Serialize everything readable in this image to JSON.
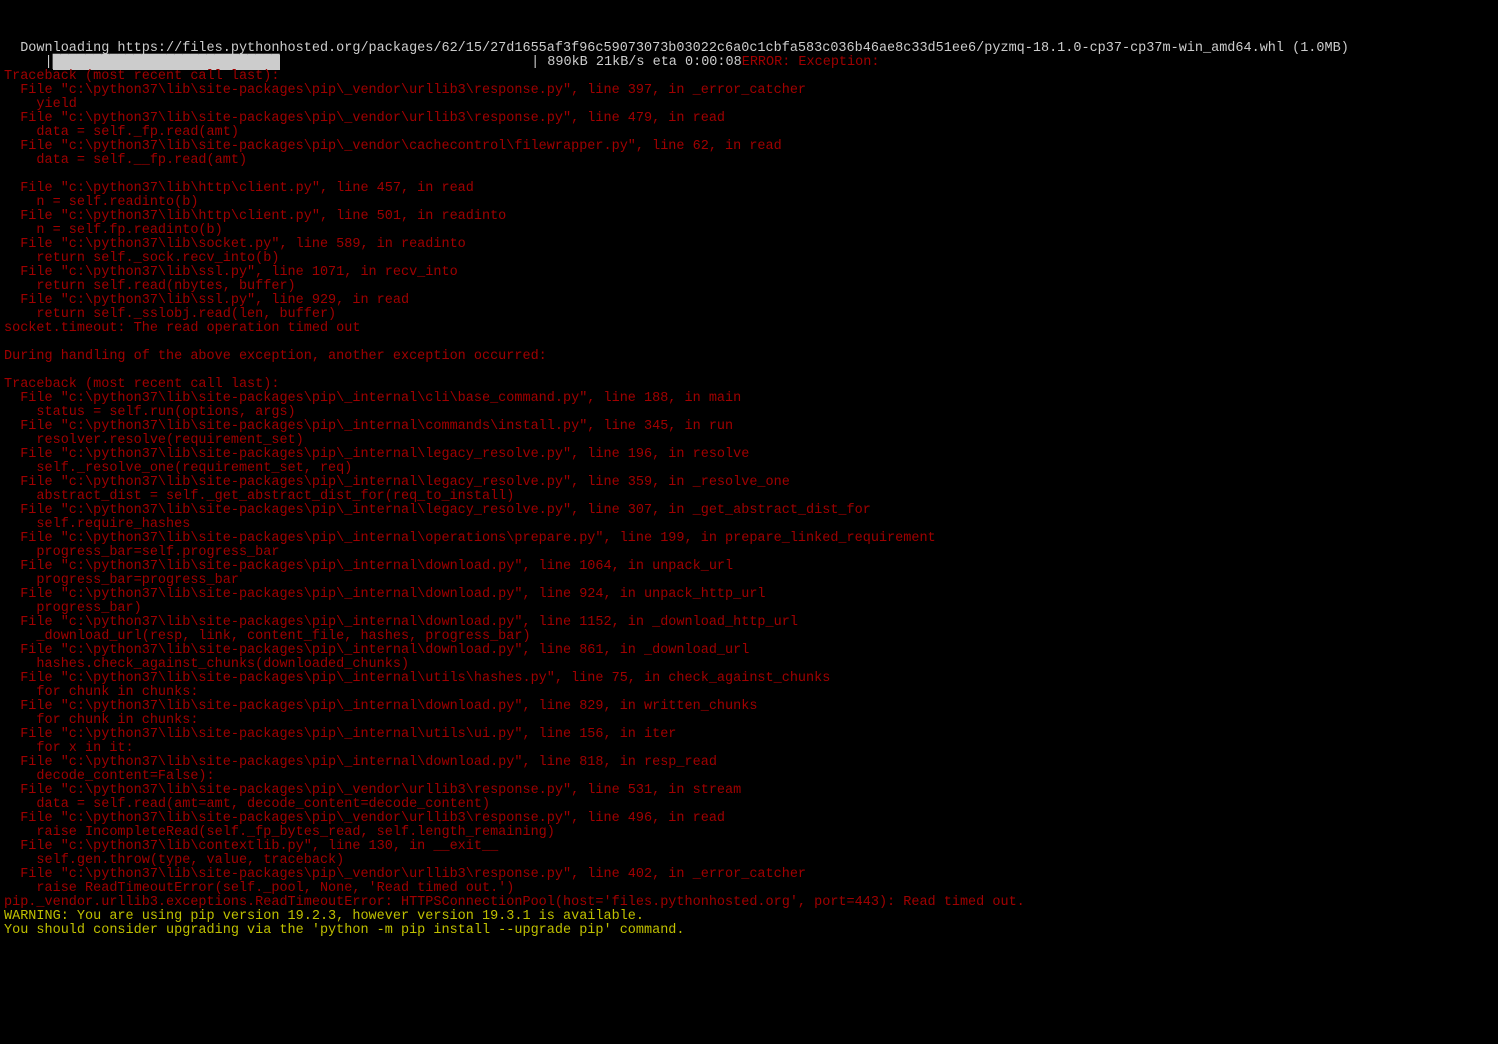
{
  "blank": " ",
  "progress": {
    "prefix": "     ",
    "filled": 28,
    "total": 59,
    "fillchar": "█",
    "emptychar": " ",
    "suffix": "| 890kB 21kB/s eta 0:00:08"
  },
  "lines": {
    "download": "  Downloading https://files.pythonhosted.org/packages/62/15/27d1655af3f96c59073073b03022c6a0c1cbfa583c036b46ae8c33d51ee6/pyzmq-18.1.0-cp37-cp37m-win_amd64.whl (1.0MB)",
    "errlabel": "ERROR: Exception:",
    "during": "During handling of the above exception, another exception occurred:",
    "warn1": "WARNING: You are using pip version 19.2.3, however version 19.3.1 is available.",
    "warn2": "You should consider upgrading via the 'python -m pip install --upgrade pip' command."
  },
  "tb1": {
    "l0": "Traceback (most recent call last):",
    "l1": "  File \"c:\\python37\\lib\\site-packages\\pip\\_vendor\\urllib3\\response.py\", line 397, in _error_catcher",
    "l2": "    yield",
    "l3": "  File \"c:\\python37\\lib\\site-packages\\pip\\_vendor\\urllib3\\response.py\", line 479, in read",
    "l4": "    data = self._fp.read(amt)",
    "l5": "  File \"c:\\python37\\lib\\site-packages\\pip\\_vendor\\cachecontrol\\filewrapper.py\", line 62, in read",
    "l6": "    data = self.__fp.read(amt)",
    "l7": " ",
    "l8": "  File \"c:\\python37\\lib\\http\\client.py\", line 457, in read",
    "l9": "    n = self.readinto(b)",
    "l10": "  File \"c:\\python37\\lib\\http\\client.py\", line 501, in readinto",
    "l11": "    n = self.fp.readinto(b)",
    "l12": "  File \"c:\\python37\\lib\\socket.py\", line 589, in readinto",
    "l13": "    return self._sock.recv_into(b)",
    "l14": "  File \"c:\\python37\\lib\\ssl.py\", line 1071, in recv_into",
    "l15": "    return self.read(nbytes, buffer)",
    "l16": "  File \"c:\\python37\\lib\\ssl.py\", line 929, in read",
    "l17": "    return self._sslobj.read(len, buffer)",
    "l18": "socket.timeout: The read operation timed out"
  },
  "tb2": {
    "l0": "Traceback (most recent call last):",
    "l1": "  File \"c:\\python37\\lib\\site-packages\\pip\\_internal\\cli\\base_command.py\", line 188, in main",
    "l2": "    status = self.run(options, args)",
    "l3": "  File \"c:\\python37\\lib\\site-packages\\pip\\_internal\\commands\\install.py\", line 345, in run",
    "l4": "    resolver.resolve(requirement_set)",
    "l5": "  File \"c:\\python37\\lib\\site-packages\\pip\\_internal\\legacy_resolve.py\", line 196, in resolve",
    "l6": "    self._resolve_one(requirement_set, req)",
    "l7": "  File \"c:\\python37\\lib\\site-packages\\pip\\_internal\\legacy_resolve.py\", line 359, in _resolve_one",
    "l8": "    abstract_dist = self._get_abstract_dist_for(req_to_install)",
    "l9": "  File \"c:\\python37\\lib\\site-packages\\pip\\_internal\\legacy_resolve.py\", line 307, in _get_abstract_dist_for",
    "l10": "    self.require_hashes",
    "l11": "  File \"c:\\python37\\lib\\site-packages\\pip\\_internal\\operations\\prepare.py\", line 199, in prepare_linked_requirement",
    "l12": "    progress_bar=self.progress_bar",
    "l13": "  File \"c:\\python37\\lib\\site-packages\\pip\\_internal\\download.py\", line 1064, in unpack_url",
    "l14": "    progress_bar=progress_bar",
    "l15": "  File \"c:\\python37\\lib\\site-packages\\pip\\_internal\\download.py\", line 924, in unpack_http_url",
    "l16": "    progress_bar)",
    "l17": "  File \"c:\\python37\\lib\\site-packages\\pip\\_internal\\download.py\", line 1152, in _download_http_url",
    "l18": "    _download_url(resp, link, content_file, hashes, progress_bar)",
    "l19": "  File \"c:\\python37\\lib\\site-packages\\pip\\_internal\\download.py\", line 861, in _download_url",
    "l20": "    hashes.check_against_chunks(downloaded_chunks)",
    "l21": "  File \"c:\\python37\\lib\\site-packages\\pip\\_internal\\utils\\hashes.py\", line 75, in check_against_chunks",
    "l22": "    for chunk in chunks:",
    "l23": "  File \"c:\\python37\\lib\\site-packages\\pip\\_internal\\download.py\", line 829, in written_chunks",
    "l24": "    for chunk in chunks:",
    "l25": "  File \"c:\\python37\\lib\\site-packages\\pip\\_internal\\utils\\ui.py\", line 156, in iter",
    "l26": "    for x in it:",
    "l27": "  File \"c:\\python37\\lib\\site-packages\\pip\\_internal\\download.py\", line 818, in resp_read",
    "l28": "    decode_content=False):",
    "l29": "  File \"c:\\python37\\lib\\site-packages\\pip\\_vendor\\urllib3\\response.py\", line 531, in stream",
    "l30": "    data = self.read(amt=amt, decode_content=decode_content)",
    "l31": "  File \"c:\\python37\\lib\\site-packages\\pip\\_vendor\\urllib3\\response.py\", line 496, in read",
    "l32": "    raise IncompleteRead(self._fp_bytes_read, self.length_remaining)",
    "l33": "  File \"c:\\python37\\lib\\contextlib.py\", line 130, in __exit__",
    "l34": "    self.gen.throw(type, value, traceback)",
    "l35": "  File \"c:\\python37\\lib\\site-packages\\pip\\_vendor\\urllib3\\response.py\", line 402, in _error_catcher",
    "l36": "    raise ReadTimeoutError(self._pool, None, 'Read timed out.')",
    "l37": "pip._vendor.urllib3.exceptions.ReadTimeoutError: HTTPSConnectionPool(host='files.pythonhosted.org', port=443): Read timed out."
  }
}
